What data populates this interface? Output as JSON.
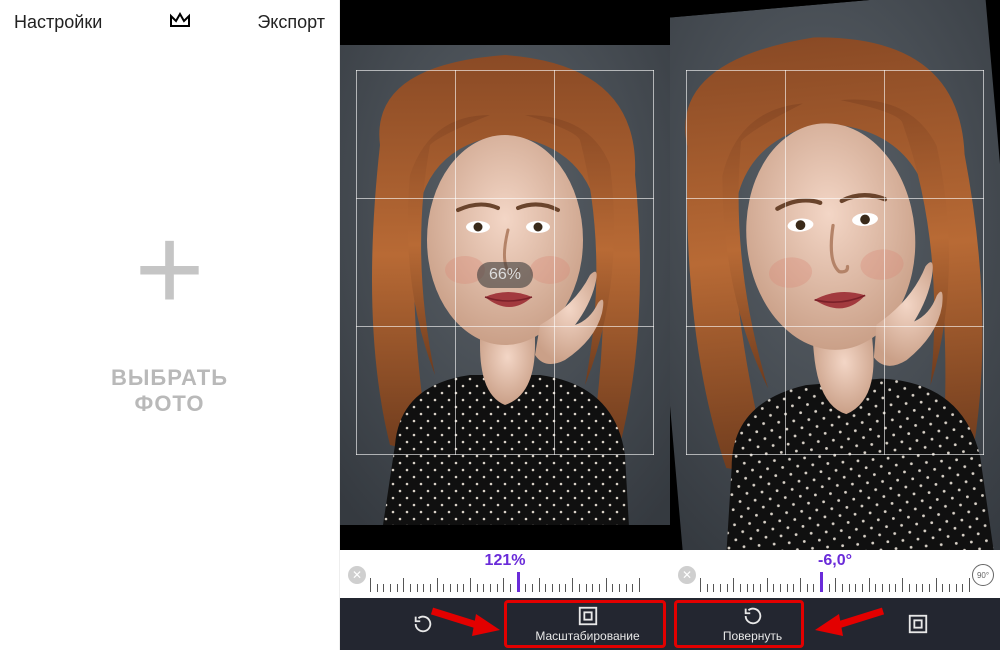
{
  "left": {
    "settings": "Настройки",
    "export": "Экспорт",
    "choose_label": "ВЫБРАТЬ ФОТО"
  },
  "mid": {
    "zoom_badge": "66%",
    "slider_value": "121%",
    "tool_rotate": "",
    "tool_scale": "Масштабирование"
  },
  "right": {
    "slider_value": "-6,0°",
    "ninety_label": "90°",
    "tool_rotate": "Повернуть",
    "tool_scale": ""
  },
  "colors": {
    "accent": "#6a2bd9",
    "highlight": "#e30000"
  }
}
